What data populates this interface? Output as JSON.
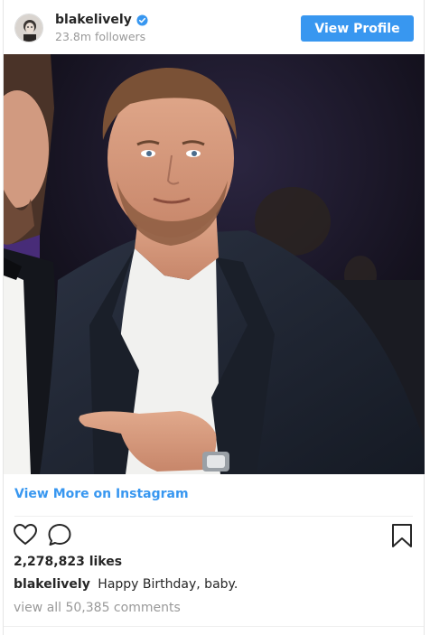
{
  "header": {
    "username": "blakelively",
    "followers": "23.8m followers",
    "view_profile_label": "View Profile",
    "verified_icon": "verified-badge-icon"
  },
  "post": {
    "image": "photo-man-in-tuxedo-pointing",
    "view_more_label": "View More on Instagram",
    "likes": "2,278,823 likes",
    "caption_user": "blakelively",
    "caption_text": "Happy Birthday, baby.",
    "comments_link": "view all 50,385 comments"
  },
  "icons": {
    "like": "heart-icon",
    "comment": "comment-icon",
    "save": "bookmark-icon"
  },
  "colors": {
    "accent": "#3897f0",
    "text": "#262626",
    "muted": "#999999"
  }
}
